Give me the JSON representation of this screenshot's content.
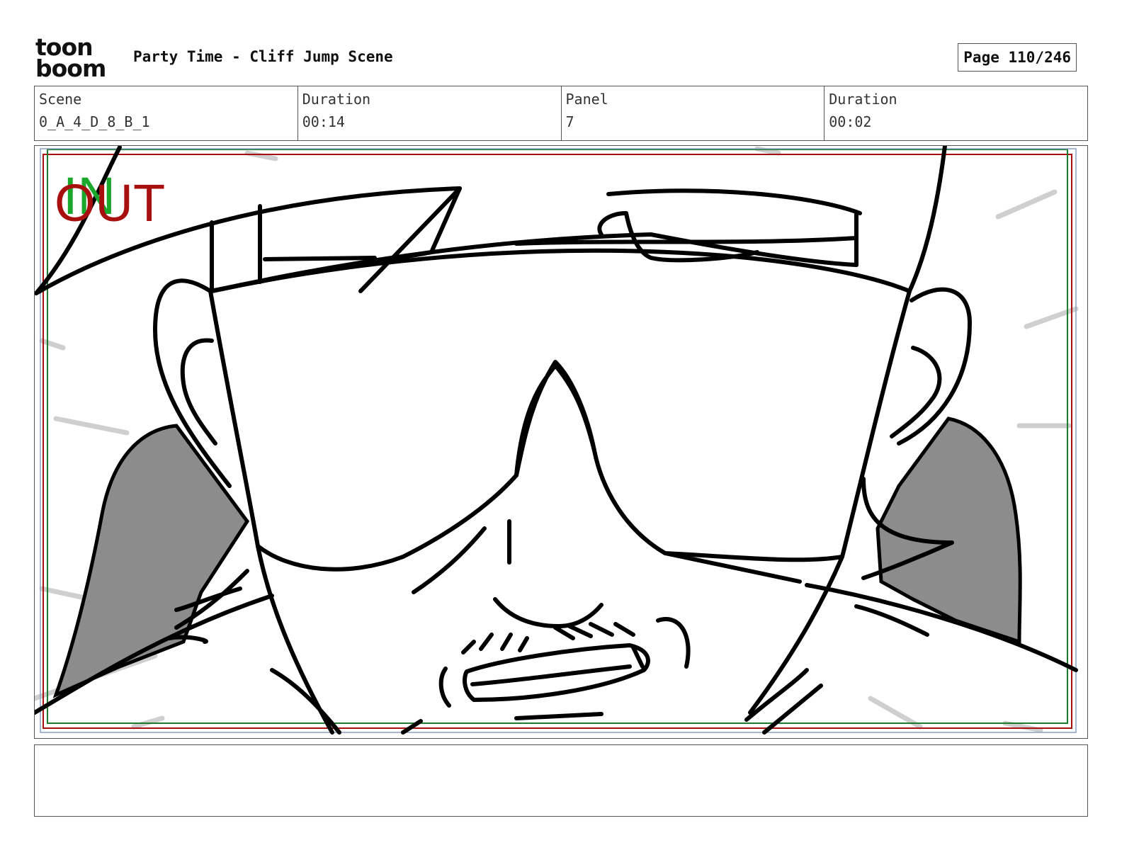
{
  "header": {
    "logo_line1": "toon",
    "logo_line2": "boom",
    "title": "Party Time - Cliff Jump Scene",
    "page": "Page 110/246"
  },
  "info": {
    "scene_label": "Scene",
    "scene_value": "0_A_4_D_8_B_1",
    "scene_duration_label": "Duration",
    "scene_duration_value": "00:14",
    "panel_label": "Panel",
    "panel_value": "7",
    "panel_duration_label": "Duration",
    "panel_duration_value": "00:02"
  },
  "panel": {
    "in_label": "IN",
    "out_label": "OUT",
    "in_color": "#19a82b",
    "out_color": "#a80f0f",
    "image_icon": "storyboard-sketch-sunglasses-character"
  },
  "notes": {
    "text": ""
  }
}
